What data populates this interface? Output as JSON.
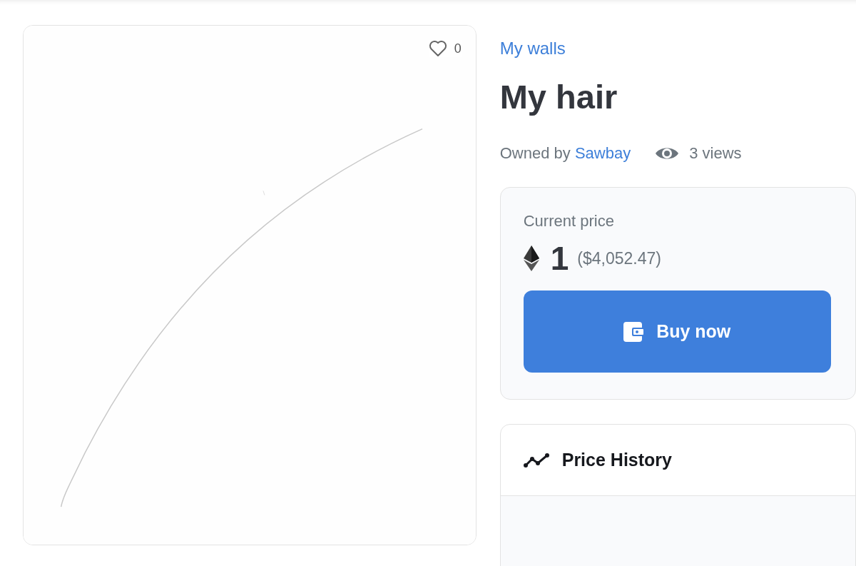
{
  "artwork": {
    "likes": "0"
  },
  "collection": "My walls",
  "title": "My hair",
  "owner": {
    "label": "Owned by",
    "name": "Sawbay"
  },
  "views": "3 views",
  "price_card": {
    "label": "Current price",
    "amount": "1",
    "fiat": "($4,052.47)",
    "button": "Buy now"
  },
  "price_history": {
    "title": "Price History"
  }
}
